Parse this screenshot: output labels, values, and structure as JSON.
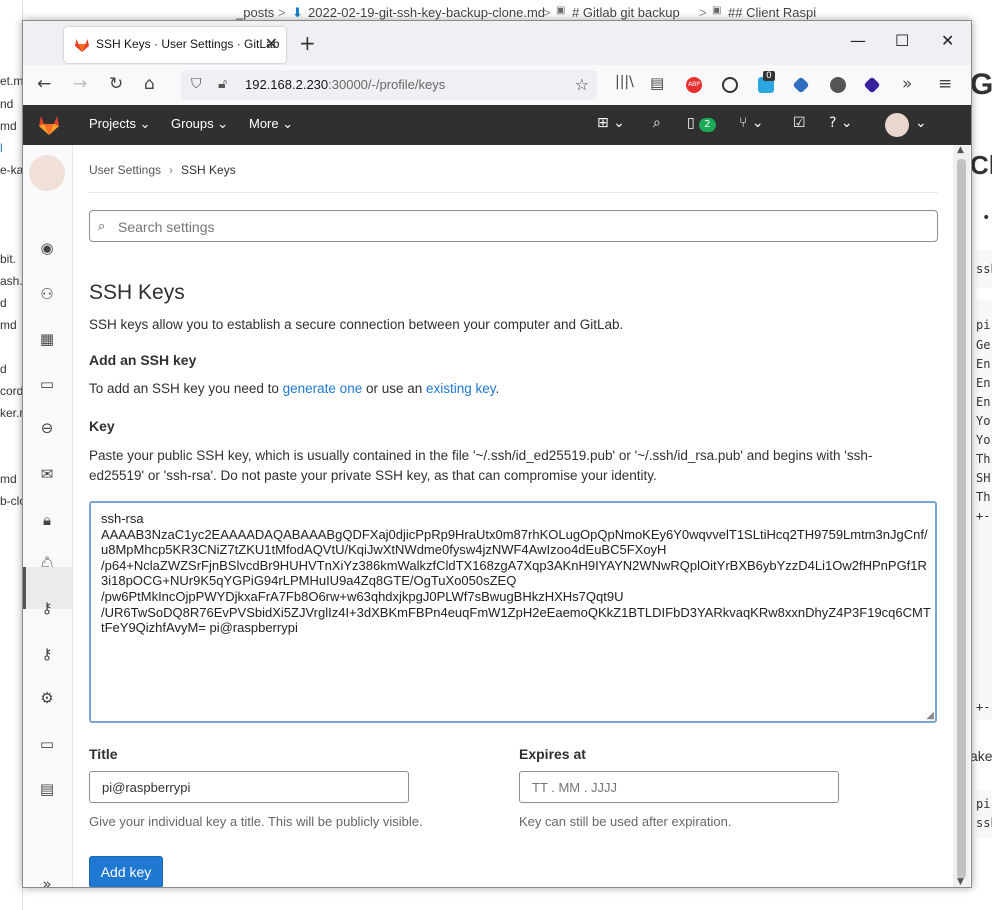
{
  "background": {
    "top_path": [
      "_posts",
      ">",
      "2022-02-19-git-ssh-key-backup-clone.md",
      ">",
      "# Gitlab git backup",
      ">",
      "## Client Raspi"
    ],
    "left_fragments": [
      "et.m",
      "nd",
      "md",
      "l",
      "e-ka",
      "bit.",
      "ash.",
      "d",
      "md",
      "d",
      "cord",
      "ker.n",
      "md",
      "b-clo"
    ],
    "right_fragments": [
      "G",
      "Cl",
      "•",
      "ssh",
      "pi",
      "Ge",
      "En",
      "En",
      "En",
      "Yo",
      "Yo",
      "Th",
      "SH",
      "Th",
      "+-",
      "+-",
      "ake",
      "pi",
      "ssh"
    ]
  },
  "browser": {
    "tab_title": "SSH Keys · User Settings · GitLab",
    "url_host": "192.168.2.230",
    "url_rest": ":30000/-/profile/keys",
    "ext_badge": "0"
  },
  "gitlab": {
    "nav": {
      "projects": "Projects",
      "groups": "Groups",
      "more": "More",
      "mr_count": "2"
    },
    "breadcrumb": {
      "parent": "User Settings",
      "current": "SSH Keys"
    },
    "search_placeholder": "Search settings",
    "page_title": "SSH Keys",
    "intro": "SSH keys allow you to establish a secure connection between your computer and GitLab.",
    "add_heading": "Add an SSH key",
    "add_text_prefix": "To add an SSH key you need to ",
    "add_link1": "generate one",
    "add_text_mid": " or use an ",
    "add_link2": "existing key",
    "add_text_suffix": ".",
    "key_label": "Key",
    "key_help": "Paste your public SSH key, which is usually contained in the file '~/.ssh/id_ed25519.pub' or '~/.ssh/id_rsa.pub' and begins with 'ssh-ed25519' or 'ssh-rsa'. Do not paste your private SSH key, as that can compromise your identity.",
    "key_value": "ssh-rsa\nAAAAB3NzaC1yc2EAAAADAQABAAABgQDFXaj0djicPpRp9HraUtx0m87rhKOLugOpQpNmoKEy6Y0wqvvelT1SLtiHcq2TH9759Lmtm3nJgCnf/u8MpMhcp5KR3CNiZ7tZKU1tMfodAQVtU/KqiJwXtNWdme0fysw4jzNWF4AwIzoo4dEuBC5FXoyH\n/p64+NclaZWZSrFjnBSlvcdBr9HUHVTnXiYz386kmWalkzfCldTX168zgA7Xqp3AKnH9IYAYN2WNwRQplOitYrBXB6ybYzzD4Li1Ow2fHPnPGf1R3i18pOCG+NUr9K5qYGPiG94rLPMHuIU9a4Zq8GTE/OgTuXo050sZEQ\n/pw6PtMkIncOjpPWYDjkxaFrA7Fb8O6rw+w63qhdxjkpgJ0PLWf7sBwugBHkzHXHs7Qqt9U\n/UR6TwSoDQ8R76EvPVSbidXi5ZJVrglIz4I+3dXBKmFBPn4euqFmW1ZpH2eEaemoQKkZ1BTLDIFbD3YARkvaqKRw8xxnDhyZ4P3F19cq6CMTtFeY9QizhfAvyM= pi@raspberrypi",
    "title_label": "Title",
    "title_value": "pi@raspberrypi",
    "title_help": "Give your individual key a title. This will be publicly visible.",
    "expires_label": "Expires at",
    "expires_placeholder": "TT . MM . JJJJ",
    "expires_help": "Key can still be used after expiration.",
    "add_button": "Add key"
  }
}
